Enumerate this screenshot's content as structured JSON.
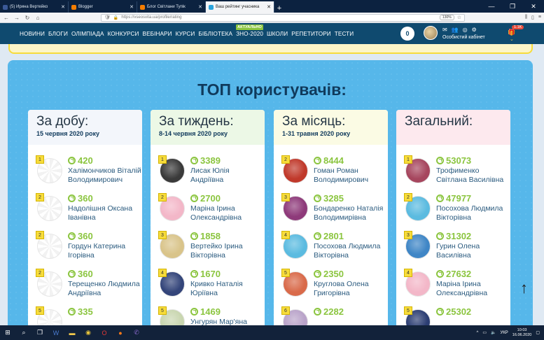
{
  "browser": {
    "tabs": [
      {
        "label": "(5) Ирина Вертейко",
        "color": "#3b5998",
        "active": false
      },
      {
        "label": "Blogger",
        "color": "#f57d00",
        "active": false
      },
      {
        "label": "Блог Світлани Тупік",
        "color": "#f57d00",
        "active": false
      },
      {
        "label": "Ваш рейтинг учасника",
        "color": "#2aa3dc",
        "active": true
      }
    ],
    "url_domain": "https://vseosvita.ua",
    "url_path": "/profile/rating",
    "zoom": "130%",
    "new_tab": "+",
    "window_controls": [
      "—",
      "❐",
      "✕"
    ]
  },
  "site_nav": {
    "items": [
      "НОВИНИ",
      "БЛОГИ",
      "ОЛІМПІАДА",
      "КОНКУРСИ",
      "ВЕБІНАРИ",
      "КУРСИ",
      "БІБЛІОТЕКА",
      "ЗНО-2020",
      "ШКОЛИ",
      "РЕПЕТИТОРИ",
      "ТЕСТИ"
    ],
    "badge": "АКТУАЛЬНО",
    "cart_count": "0",
    "cabinet_label": "Особистий кабінет",
    "coins_label": "1.1K"
  },
  "page": {
    "title": "ТОП користувачів:"
  },
  "columns": [
    {
      "title": "За добу:",
      "date": "15 червня 2020 року",
      "header_bg": "#f3f6fb",
      "entries": [
        {
          "rank": "1",
          "score": "420",
          "name": "Халімончиков Віталій Володимирович",
          "avatar": "blank"
        },
        {
          "rank": "2",
          "score": "360",
          "name": "Надолішня Оксана Іванівна",
          "avatar": "blank"
        },
        {
          "rank": "2",
          "score": "360",
          "name": "Гордун Катерина Ігорівна",
          "avatar": "blank"
        },
        {
          "rank": "2",
          "score": "360",
          "name": "Терещенко Людмила Андріївна",
          "avatar": "blank"
        },
        {
          "rank": "5",
          "score": "335",
          "name": "",
          "avatar": "blank"
        }
      ]
    },
    {
      "title": "За тиждень:",
      "date": "8-14 червня 2020 року",
      "header_bg": "#ecf8e6",
      "entries": [
        {
          "rank": "1",
          "score": "3389",
          "name": "Лисак Юлія Андріївна",
          "avatar": "#3a3a3a"
        },
        {
          "rank": "2",
          "score": "2700",
          "name": "Маріна Ірина Олександрівна",
          "avatar": "#f3b7c8"
        },
        {
          "rank": "3",
          "score": "1858",
          "name": "Вертейко Ірина Вікторівна",
          "avatar": "#d9c48a"
        },
        {
          "rank": "4",
          "score": "1670",
          "name": "Кривко Наталія Юріївна",
          "avatar": "#34457a"
        },
        {
          "rank": "5",
          "score": "1469",
          "name": "Унгурян Мар'яна",
          "avatar": "#c9d6b0"
        }
      ]
    },
    {
      "title": "За місяць:",
      "date": "1-31 травня 2020 року",
      "header_bg": "#fbfbe4",
      "entries": [
        {
          "rank": "2",
          "score": "8444",
          "name": "Гоман Роман Володимирович",
          "avatar": "#c0392b"
        },
        {
          "rank": "3",
          "score": "3285",
          "name": "Бондаренко Наталія Володимирівна",
          "avatar": "#8e3a7a"
        },
        {
          "rank": "4",
          "score": "2801",
          "name": "Посохова Людмила Вікторівна",
          "avatar": "#5bbbe0"
        },
        {
          "rank": "5",
          "score": "2350",
          "name": "Круглова Олена Григорівна",
          "avatar": "#d96a4a"
        },
        {
          "rank": "6",
          "score": "2282",
          "name": "",
          "avatar": "#b9a3c9"
        }
      ]
    },
    {
      "title": "Загальний:",
      "date": "",
      "header_bg": "#fde9ee",
      "entries": [
        {
          "rank": "1",
          "score": "53073",
          "name": "Трофименко Світлана Василівна",
          "avatar": "#a6465e"
        },
        {
          "rank": "2",
          "score": "47977",
          "name": "Посохова Людмила Вікторівна",
          "avatar": "#5bbbe0"
        },
        {
          "rank": "3",
          "score": "31302",
          "name": "Гурин Олена Василівна",
          "avatar": "#3f86c6"
        },
        {
          "rank": "4",
          "score": "27632",
          "name": "Маріна Ірина Олександрівна",
          "avatar": "#f3b7c8"
        },
        {
          "rank": "5",
          "score": "25302",
          "name": "",
          "avatar": "#2c3e73"
        }
      ]
    }
  ],
  "taskbar": {
    "language": "УКР",
    "time": "10:03",
    "date": "16.06.2020"
  }
}
